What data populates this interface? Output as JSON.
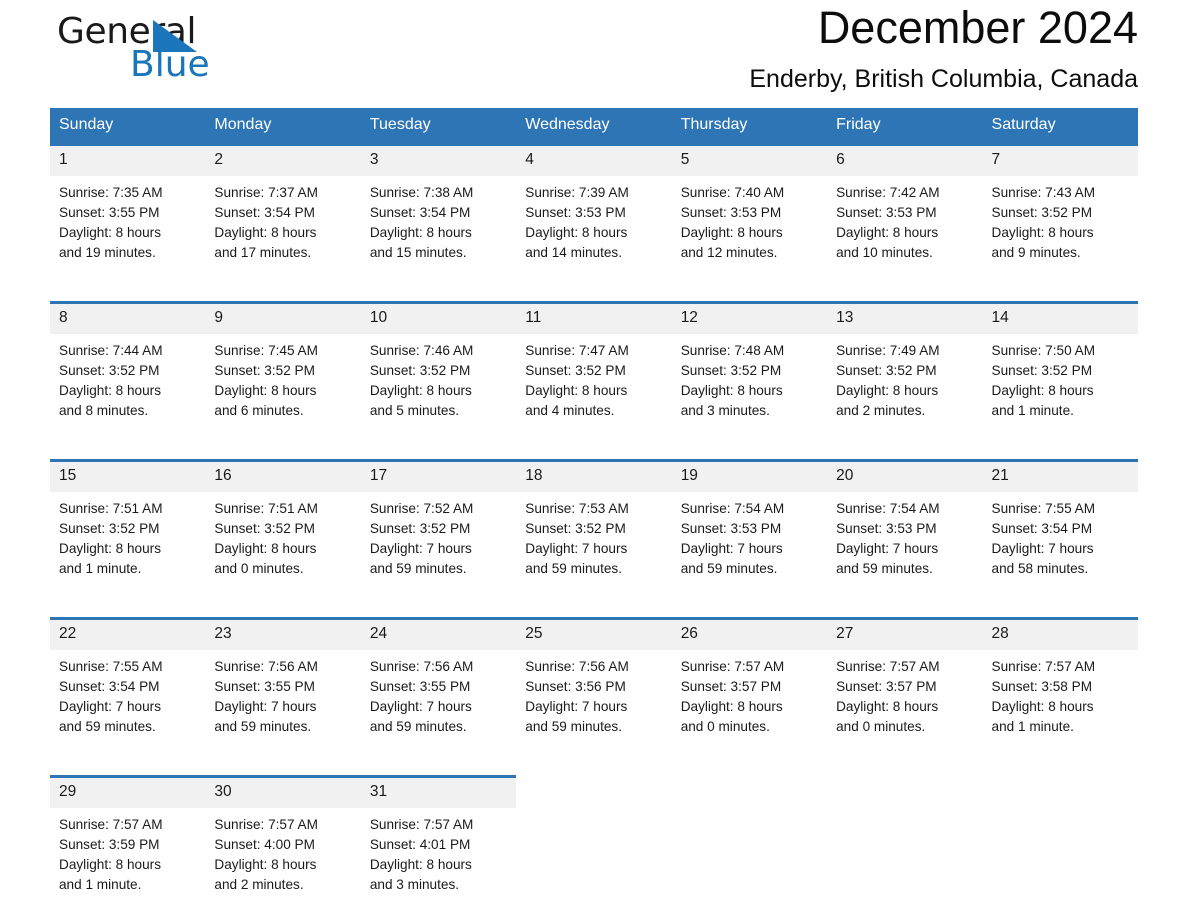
{
  "brand": {
    "line1": "General",
    "line2": "Blue",
    "triangle_color": "#1B75BB",
    "logo_icon": "triangle-flag-icon"
  },
  "header": {
    "month_title": "December 2024",
    "location": "Enderby, British Columbia, Canada"
  },
  "theme": {
    "header_blue": "#2E75B6",
    "daynum_bg": "#F1F1F1",
    "text": "#1a1a1a"
  },
  "calendar": {
    "weekday_headers": [
      "Sunday",
      "Monday",
      "Tuesday",
      "Wednesday",
      "Thursday",
      "Friday",
      "Saturday"
    ],
    "weeks": [
      [
        {
          "day": "1",
          "sunrise": "Sunrise: 7:35 AM",
          "sunset": "Sunset: 3:55 PM",
          "daylight_1": "Daylight: 8 hours",
          "daylight_2": "and 19 minutes."
        },
        {
          "day": "2",
          "sunrise": "Sunrise: 7:37 AM",
          "sunset": "Sunset: 3:54 PM",
          "daylight_1": "Daylight: 8 hours",
          "daylight_2": "and 17 minutes."
        },
        {
          "day": "3",
          "sunrise": "Sunrise: 7:38 AM",
          "sunset": "Sunset: 3:54 PM",
          "daylight_1": "Daylight: 8 hours",
          "daylight_2": "and 15 minutes."
        },
        {
          "day": "4",
          "sunrise": "Sunrise: 7:39 AM",
          "sunset": "Sunset: 3:53 PM",
          "daylight_1": "Daylight: 8 hours",
          "daylight_2": "and 14 minutes."
        },
        {
          "day": "5",
          "sunrise": "Sunrise: 7:40 AM",
          "sunset": "Sunset: 3:53 PM",
          "daylight_1": "Daylight: 8 hours",
          "daylight_2": "and 12 minutes."
        },
        {
          "day": "6",
          "sunrise": "Sunrise: 7:42 AM",
          "sunset": "Sunset: 3:53 PM",
          "daylight_1": "Daylight: 8 hours",
          "daylight_2": "and 10 minutes."
        },
        {
          "day": "7",
          "sunrise": "Sunrise: 7:43 AM",
          "sunset": "Sunset: 3:52 PM",
          "daylight_1": "Daylight: 8 hours",
          "daylight_2": "and 9 minutes."
        }
      ],
      [
        {
          "day": "8",
          "sunrise": "Sunrise: 7:44 AM",
          "sunset": "Sunset: 3:52 PM",
          "daylight_1": "Daylight: 8 hours",
          "daylight_2": "and 8 minutes."
        },
        {
          "day": "9",
          "sunrise": "Sunrise: 7:45 AM",
          "sunset": "Sunset: 3:52 PM",
          "daylight_1": "Daylight: 8 hours",
          "daylight_2": "and 6 minutes."
        },
        {
          "day": "10",
          "sunrise": "Sunrise: 7:46 AM",
          "sunset": "Sunset: 3:52 PM",
          "daylight_1": "Daylight: 8 hours",
          "daylight_2": "and 5 minutes."
        },
        {
          "day": "11",
          "sunrise": "Sunrise: 7:47 AM",
          "sunset": "Sunset: 3:52 PM",
          "daylight_1": "Daylight: 8 hours",
          "daylight_2": "and 4 minutes."
        },
        {
          "day": "12",
          "sunrise": "Sunrise: 7:48 AM",
          "sunset": "Sunset: 3:52 PM",
          "daylight_1": "Daylight: 8 hours",
          "daylight_2": "and 3 minutes."
        },
        {
          "day": "13",
          "sunrise": "Sunrise: 7:49 AM",
          "sunset": "Sunset: 3:52 PM",
          "daylight_1": "Daylight: 8 hours",
          "daylight_2": "and 2 minutes."
        },
        {
          "day": "14",
          "sunrise": "Sunrise: 7:50 AM",
          "sunset": "Sunset: 3:52 PM",
          "daylight_1": "Daylight: 8 hours",
          "daylight_2": "and 1 minute."
        }
      ],
      [
        {
          "day": "15",
          "sunrise": "Sunrise: 7:51 AM",
          "sunset": "Sunset: 3:52 PM",
          "daylight_1": "Daylight: 8 hours",
          "daylight_2": "and 1 minute."
        },
        {
          "day": "16",
          "sunrise": "Sunrise: 7:51 AM",
          "sunset": "Sunset: 3:52 PM",
          "daylight_1": "Daylight: 8 hours",
          "daylight_2": "and 0 minutes."
        },
        {
          "day": "17",
          "sunrise": "Sunrise: 7:52 AM",
          "sunset": "Sunset: 3:52 PM",
          "daylight_1": "Daylight: 7 hours",
          "daylight_2": "and 59 minutes."
        },
        {
          "day": "18",
          "sunrise": "Sunrise: 7:53 AM",
          "sunset": "Sunset: 3:52 PM",
          "daylight_1": "Daylight: 7 hours",
          "daylight_2": "and 59 minutes."
        },
        {
          "day": "19",
          "sunrise": "Sunrise: 7:54 AM",
          "sunset": "Sunset: 3:53 PM",
          "daylight_1": "Daylight: 7 hours",
          "daylight_2": "and 59 minutes."
        },
        {
          "day": "20",
          "sunrise": "Sunrise: 7:54 AM",
          "sunset": "Sunset: 3:53 PM",
          "daylight_1": "Daylight: 7 hours",
          "daylight_2": "and 59 minutes."
        },
        {
          "day": "21",
          "sunrise": "Sunrise: 7:55 AM",
          "sunset": "Sunset: 3:54 PM",
          "daylight_1": "Daylight: 7 hours",
          "daylight_2": "and 58 minutes."
        }
      ],
      [
        {
          "day": "22",
          "sunrise": "Sunrise: 7:55 AM",
          "sunset": "Sunset: 3:54 PM",
          "daylight_1": "Daylight: 7 hours",
          "daylight_2": "and 59 minutes."
        },
        {
          "day": "23",
          "sunrise": "Sunrise: 7:56 AM",
          "sunset": "Sunset: 3:55 PM",
          "daylight_1": "Daylight: 7 hours",
          "daylight_2": "and 59 minutes."
        },
        {
          "day": "24",
          "sunrise": "Sunrise: 7:56 AM",
          "sunset": "Sunset: 3:55 PM",
          "daylight_1": "Daylight: 7 hours",
          "daylight_2": "and 59 minutes."
        },
        {
          "day": "25",
          "sunrise": "Sunrise: 7:56 AM",
          "sunset": "Sunset: 3:56 PM",
          "daylight_1": "Daylight: 7 hours",
          "daylight_2": "and 59 minutes."
        },
        {
          "day": "26",
          "sunrise": "Sunrise: 7:57 AM",
          "sunset": "Sunset: 3:57 PM",
          "daylight_1": "Daylight: 8 hours",
          "daylight_2": "and 0 minutes."
        },
        {
          "day": "27",
          "sunrise": "Sunrise: 7:57 AM",
          "sunset": "Sunset: 3:57 PM",
          "daylight_1": "Daylight: 8 hours",
          "daylight_2": "and 0 minutes."
        },
        {
          "day": "28",
          "sunrise": "Sunrise: 7:57 AM",
          "sunset": "Sunset: 3:58 PM",
          "daylight_1": "Daylight: 8 hours",
          "daylight_2": "and 1 minute."
        }
      ],
      [
        {
          "day": "29",
          "sunrise": "Sunrise: 7:57 AM",
          "sunset": "Sunset: 3:59 PM",
          "daylight_1": "Daylight: 8 hours",
          "daylight_2": "and 1 minute."
        },
        {
          "day": "30",
          "sunrise": "Sunrise: 7:57 AM",
          "sunset": "Sunset: 4:00 PM",
          "daylight_1": "Daylight: 8 hours",
          "daylight_2": "and 2 minutes."
        },
        {
          "day": "31",
          "sunrise": "Sunrise: 7:57 AM",
          "sunset": "Sunset: 4:01 PM",
          "daylight_1": "Daylight: 8 hours",
          "daylight_2": "and 3 minutes."
        },
        {
          "day": "",
          "sunrise": "",
          "sunset": "",
          "daylight_1": "",
          "daylight_2": ""
        },
        {
          "day": "",
          "sunrise": "",
          "sunset": "",
          "daylight_1": "",
          "daylight_2": ""
        },
        {
          "day": "",
          "sunrise": "",
          "sunset": "",
          "daylight_1": "",
          "daylight_2": ""
        },
        {
          "day": "",
          "sunrise": "",
          "sunset": "",
          "daylight_1": "",
          "daylight_2": ""
        }
      ]
    ]
  }
}
